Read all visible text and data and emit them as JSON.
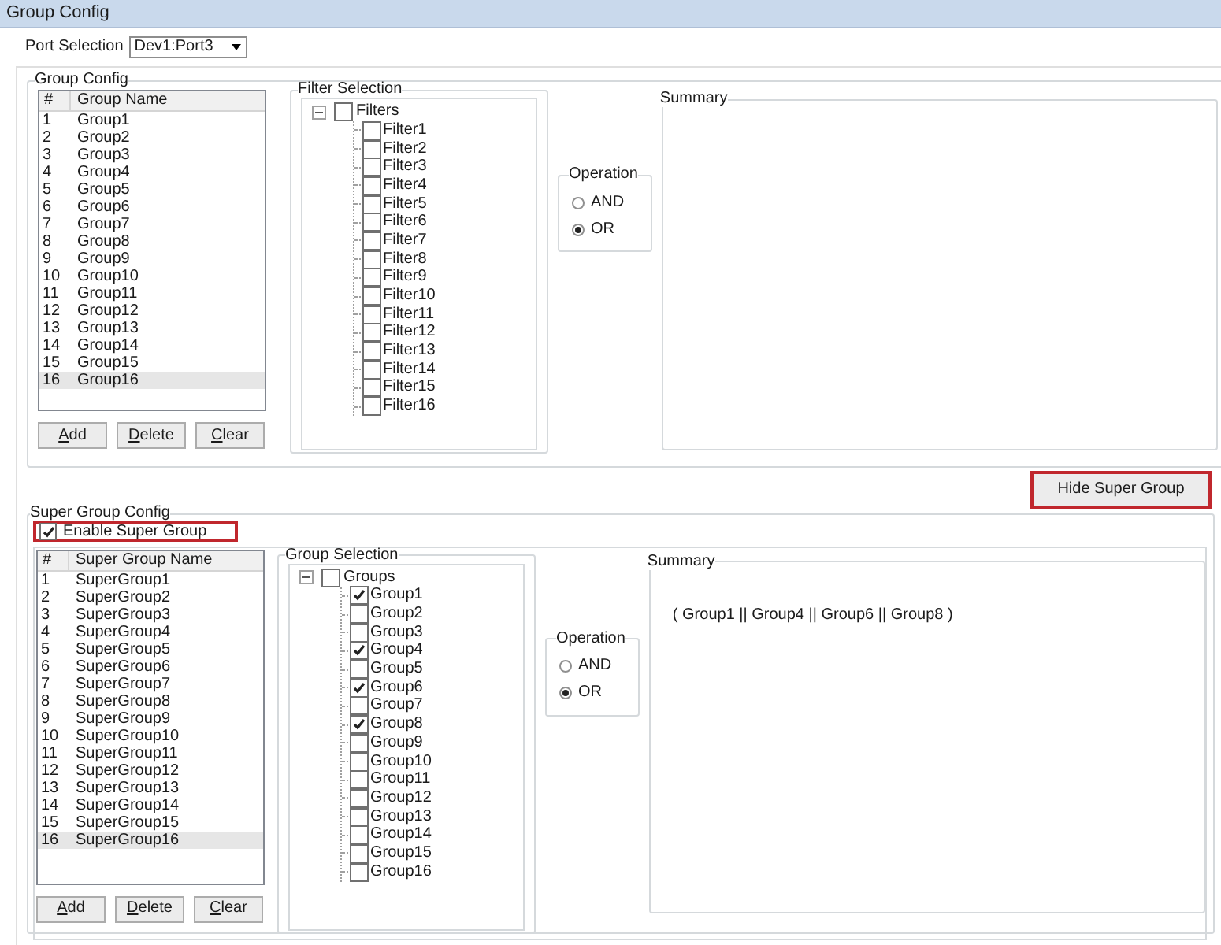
{
  "window": {
    "title": "Group Config"
  },
  "port_selection": {
    "label": "Port Selection",
    "value": "Dev1:Port3"
  },
  "group_config": {
    "title": "Group Config",
    "list": {
      "columns": [
        "#",
        "Group Name"
      ],
      "rows": [
        {
          "cells": [
            "1",
            "Group1"
          ],
          "selected": false
        },
        {
          "cells": [
            "2",
            "Group2"
          ],
          "selected": false
        },
        {
          "cells": [
            "3",
            "Group3"
          ],
          "selected": false
        },
        {
          "cells": [
            "4",
            "Group4"
          ],
          "selected": false
        },
        {
          "cells": [
            "5",
            "Group5"
          ],
          "selected": false
        },
        {
          "cells": [
            "6",
            "Group6"
          ],
          "selected": false
        },
        {
          "cells": [
            "7",
            "Group7"
          ],
          "selected": false
        },
        {
          "cells": [
            "8",
            "Group8"
          ],
          "selected": false
        },
        {
          "cells": [
            "9",
            "Group9"
          ],
          "selected": false
        },
        {
          "cells": [
            "10",
            "Group10"
          ],
          "selected": false
        },
        {
          "cells": [
            "11",
            "Group11"
          ],
          "selected": false
        },
        {
          "cells": [
            "12",
            "Group12"
          ],
          "selected": false
        },
        {
          "cells": [
            "13",
            "Group13"
          ],
          "selected": false
        },
        {
          "cells": [
            "14",
            "Group14"
          ],
          "selected": false
        },
        {
          "cells": [
            "15",
            "Group15"
          ],
          "selected": false
        },
        {
          "cells": [
            "16",
            "Group16"
          ],
          "selected": true
        }
      ]
    },
    "buttons": [
      "Add",
      "Delete",
      "Clear"
    ],
    "selection": {
      "title": "Filter Selection",
      "tree": {
        "label": "Filters",
        "checked": false,
        "expanded": true,
        "children": [
          {
            "label": "Filter1",
            "checked": false
          },
          {
            "label": "Filter2",
            "checked": false
          },
          {
            "label": "Filter3",
            "checked": false
          },
          {
            "label": "Filter4",
            "checked": false
          },
          {
            "label": "Filter5",
            "checked": false
          },
          {
            "label": "Filter6",
            "checked": false
          },
          {
            "label": "Filter7",
            "checked": false
          },
          {
            "label": "Filter8",
            "checked": false
          },
          {
            "label": "Filter9",
            "checked": false
          },
          {
            "label": "Filter10",
            "checked": false
          },
          {
            "label": "Filter11",
            "checked": false
          },
          {
            "label": "Filter12",
            "checked": false
          },
          {
            "label": "Filter13",
            "checked": false
          },
          {
            "label": "Filter14",
            "checked": false
          },
          {
            "label": "Filter15",
            "checked": false
          },
          {
            "label": "Filter16",
            "checked": false
          }
        ]
      }
    },
    "operation": {
      "title": "Operation",
      "options": [
        {
          "label": "AND",
          "selected": false
        },
        {
          "label": "OR",
          "selected": true
        }
      ]
    },
    "summary": {
      "title": "Summary"
    }
  },
  "hide_button": {
    "label": "Hide Super Group",
    "highlighted": true
  },
  "super_group_config": {
    "title": "Super Group Config",
    "enable": {
      "label": "Enable Super Group",
      "checked": true,
      "highlighted": true
    },
    "list": {
      "columns": [
        "#",
        "Super Group Name"
      ],
      "rows": [
        {
          "cells": [
            "1",
            "SuperGroup1"
          ],
          "selected": false
        },
        {
          "cells": [
            "2",
            "SuperGroup2"
          ],
          "selected": false
        },
        {
          "cells": [
            "3",
            "SuperGroup3"
          ],
          "selected": false
        },
        {
          "cells": [
            "4",
            "SuperGroup4"
          ],
          "selected": false
        },
        {
          "cells": [
            "5",
            "SuperGroup5"
          ],
          "selected": false
        },
        {
          "cells": [
            "6",
            "SuperGroup6"
          ],
          "selected": false
        },
        {
          "cells": [
            "7",
            "SuperGroup7"
          ],
          "selected": false
        },
        {
          "cells": [
            "8",
            "SuperGroup8"
          ],
          "selected": false
        },
        {
          "cells": [
            "9",
            "SuperGroup9"
          ],
          "selected": false
        },
        {
          "cells": [
            "10",
            "SuperGroup10"
          ],
          "selected": false
        },
        {
          "cells": [
            "11",
            "SuperGroup11"
          ],
          "selected": false
        },
        {
          "cells": [
            "12",
            "SuperGroup12"
          ],
          "selected": false
        },
        {
          "cells": [
            "13",
            "SuperGroup13"
          ],
          "selected": false
        },
        {
          "cells": [
            "14",
            "SuperGroup14"
          ],
          "selected": false
        },
        {
          "cells": [
            "15",
            "SuperGroup15"
          ],
          "selected": false
        },
        {
          "cells": [
            "16",
            "SuperGroup16"
          ],
          "selected": true
        }
      ]
    },
    "buttons": [
      "Add",
      "Delete",
      "Clear"
    ],
    "selection": {
      "title": "Group Selection",
      "tree": {
        "label": "Groups",
        "checked": false,
        "expanded": true,
        "children": [
          {
            "label": "Group1",
            "checked": true
          },
          {
            "label": "Group2",
            "checked": false
          },
          {
            "label": "Group3",
            "checked": false
          },
          {
            "label": "Group4",
            "checked": true
          },
          {
            "label": "Group5",
            "checked": false
          },
          {
            "label": "Group6",
            "checked": true
          },
          {
            "label": "Group7",
            "checked": false
          },
          {
            "label": "Group8",
            "checked": true
          },
          {
            "label": "Group9",
            "checked": false
          },
          {
            "label": "Group10",
            "checked": false
          },
          {
            "label": "Group11",
            "checked": false
          },
          {
            "label": "Group12",
            "checked": false
          },
          {
            "label": "Group13",
            "checked": false
          },
          {
            "label": "Group14",
            "checked": false
          },
          {
            "label": "Group15",
            "checked": false
          },
          {
            "label": "Group16",
            "checked": false
          }
        ]
      }
    },
    "operation": {
      "title": "Operation",
      "options": [
        {
          "label": "AND",
          "selected": false
        },
        {
          "label": "OR",
          "selected": true
        }
      ]
    },
    "summary": {
      "title": "Summary",
      "text": "( Group1 || Group4 || Group6 || Group8 )"
    }
  }
}
